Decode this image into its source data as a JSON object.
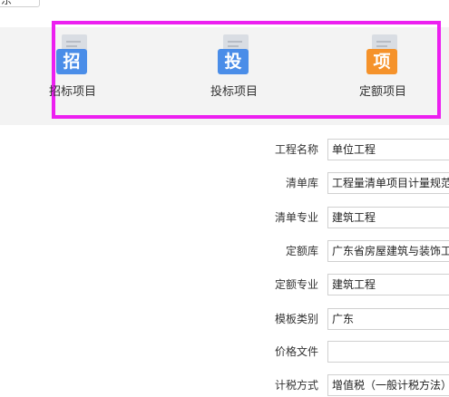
{
  "top": {
    "button_label": "东"
  },
  "projects": [
    {
      "label": "招标项目",
      "glyph": "招",
      "color": "#4a8de8"
    },
    {
      "label": "投标项目",
      "glyph": "投",
      "color": "#4a8de8"
    },
    {
      "label": "定额项目",
      "glyph": "项",
      "color": "#f5922a"
    }
  ],
  "form": {
    "project_name": {
      "label": "工程名称",
      "value": "单位工程"
    },
    "bill_library": {
      "label": "清单库",
      "value": "工程量清单项目计量规范"
    },
    "bill_specialty": {
      "label": "清单专业",
      "value": "建筑工程"
    },
    "quota_library": {
      "label": "定额库",
      "value": "广东省房屋建筑与装饰工程"
    },
    "quota_specialty": {
      "label": "定额专业",
      "value": "建筑工程"
    },
    "template_category": {
      "label": "模板类别",
      "value": "广东"
    },
    "price_file": {
      "label": "价格文件",
      "value": ""
    },
    "partial": {
      "label": "计税方式",
      "value": "增值税（一般计税方法）"
    }
  }
}
